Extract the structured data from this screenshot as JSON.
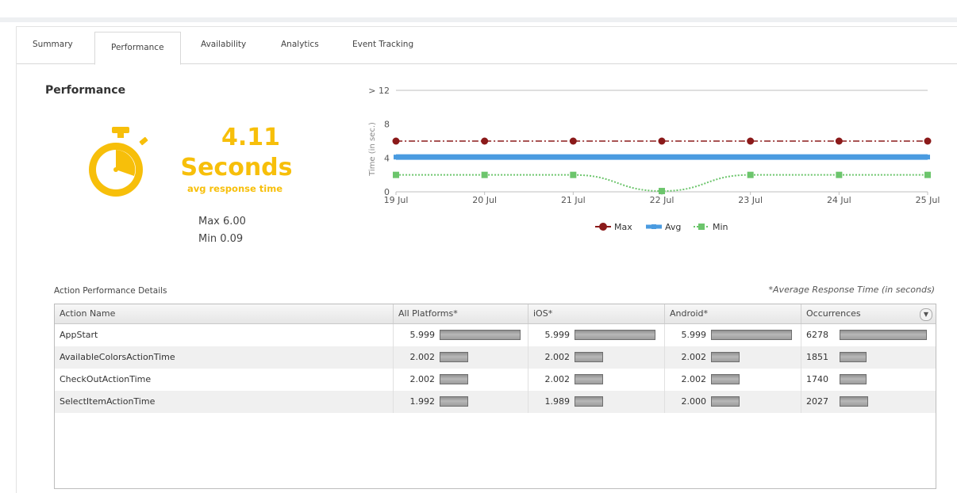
{
  "tabs": [
    {
      "label": "Summary"
    },
    {
      "label": "Performance"
    },
    {
      "label": "Availability"
    },
    {
      "label": "Analytics"
    },
    {
      "label": "Event Tracking"
    }
  ],
  "active_tab": "Performance",
  "section_title": "Performance",
  "summary": {
    "value": "4.11",
    "unit": "Seconds",
    "subtitle": "avg response time",
    "max_text": "Max 6.00",
    "min_text": "Min 0.09",
    "accent_color": "#f7bf0a"
  },
  "chart_data": {
    "type": "line",
    "ylabel": "Time (in sec.)",
    "y_ticks": [
      "0",
      "4",
      "8",
      "> 12"
    ],
    "ylim": [
      0,
      12
    ],
    "categories": [
      "19 Jul",
      "20 Jul",
      "21 Jul",
      "22 Jul",
      "23 Jul",
      "24 Jul",
      "25 Jul"
    ],
    "series": [
      {
        "name": "Max",
        "color": "#8b1a1a",
        "values": [
          6.0,
          6.0,
          6.0,
          6.0,
          6.0,
          6.0,
          6.0
        ]
      },
      {
        "name": "Avg",
        "color": "#4a9be0",
        "values": [
          4.11,
          4.11,
          4.11,
          4.11,
          4.11,
          4.11,
          4.11
        ]
      },
      {
        "name": "Min",
        "color": "#6cc56c",
        "values": [
          2.0,
          2.0,
          2.0,
          0.09,
          2.0,
          2.0,
          2.0
        ]
      }
    ],
    "legend_position": "bottom-center",
    "grid": true
  },
  "table": {
    "title": "Action Performance Details",
    "note": "*Average Response Time (in seconds)",
    "columns": [
      "Action Name",
      "All Platforms*",
      "iOS*",
      "Android*",
      "Occurrences"
    ],
    "sort_icon": "chevron-down-icon",
    "rows": [
      {
        "name": "AppStart",
        "all": "5.999",
        "ios": "5.999",
        "android": "5.999",
        "occ": "6278"
      },
      {
        "name": "AvailableColorsActionTime",
        "all": "2.002",
        "ios": "2.002",
        "android": "2.002",
        "occ": "1851"
      },
      {
        "name": "CheckOutActionTime",
        "all": "2.002",
        "ios": "2.002",
        "android": "2.002",
        "occ": "1740"
      },
      {
        "name": "SelectItemActionTime",
        "all": "1.992",
        "ios": "1.989",
        "android": "2.000",
        "occ": "2027"
      }
    ]
  }
}
